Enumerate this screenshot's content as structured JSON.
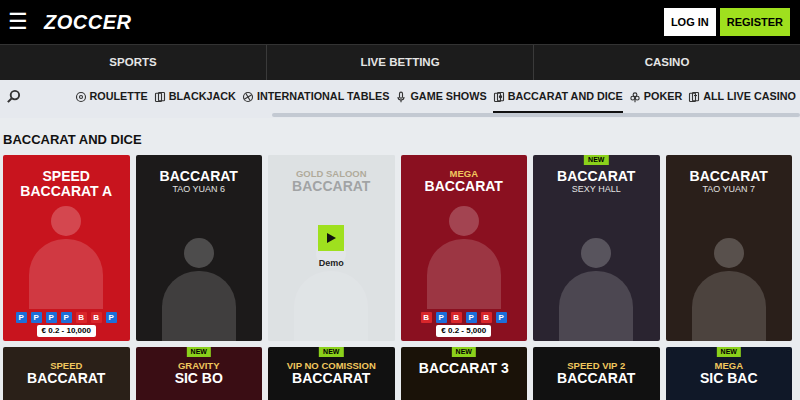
{
  "header": {
    "menu_icon": "☰",
    "logo": "ZOCCER",
    "login": "LOG IN",
    "register": "REGISTER"
  },
  "main_nav": [
    {
      "label": "SPORTS",
      "selected": false
    },
    {
      "label": "LIVE BETTING",
      "selected": false
    },
    {
      "label": "CASINO",
      "selected": false
    }
  ],
  "categories": [
    {
      "label": "ROULETTE",
      "selected": false
    },
    {
      "label": "BLACKJACK",
      "selected": false
    },
    {
      "label": "INTERNATIONAL TABLES",
      "selected": false
    },
    {
      "label": "GAME SHOWS",
      "selected": false
    },
    {
      "label": "BACCARAT AND DICE",
      "selected": true
    },
    {
      "label": "POKER",
      "selected": false
    },
    {
      "label": "ALL LIVE CASINO",
      "selected": false
    }
  ],
  "category_scroll": {
    "level": 0.66
  },
  "section_title": "BACCARAT AND DICE",
  "games": [
    {
      "tag": "",
      "title": "SPEED BACCARAT A",
      "subtitle": "",
      "color": "#c8141e",
      "hover": false,
      "road": [
        "P",
        "P",
        "P",
        "P",
        "B",
        "B",
        "P"
      ],
      "limits": "€ 0.2 - 10,000"
    },
    {
      "tag": "",
      "title": "BACCARAT",
      "subtitle": "TAO YUAN 6",
      "color": "#1c1a1a",
      "hover": false
    },
    {
      "tag": "GOLD SALOON",
      "title": "BACCARAT",
      "subtitle": "",
      "color": "#cfd2d6",
      "hover": true,
      "demo_label": "Demo"
    },
    {
      "tag": "MEGA",
      "title": "BACCARAT",
      "subtitle": "",
      "color": "#8a1020",
      "hover": false,
      "road": [
        "B",
        "P",
        "B",
        "P",
        "B",
        "P"
      ],
      "limits": "€ 0.2 - 5,000"
    },
    {
      "tag": "",
      "title": "BACCARAT",
      "subtitle": "SEXY HALL",
      "color": "#2a2430",
      "hover": false,
      "badge": "NEW"
    },
    {
      "tag": "",
      "title": "BACCARAT",
      "subtitle": "TAO YUAN 7",
      "color": "#2a1f1a",
      "hover": false
    },
    {
      "tag": "SPEED",
      "title": "BACCARAT",
      "subtitle": "",
      "color": "#2a2018",
      "hover": false
    },
    {
      "tag": "GRAVITY",
      "title": "SIC BO",
      "subtitle": "",
      "color": "#3a0d14",
      "hover": false,
      "badge": "NEW"
    },
    {
      "tag": "VIP NO COMISSION",
      "title": "BACCARAT",
      "subtitle": "",
      "color": "#111111",
      "hover": false,
      "badge": "NEW"
    },
    {
      "tag": "",
      "title": "BACCARAT 3",
      "subtitle": "",
      "color": "#1a1208",
      "hover": false,
      "badge": "NEW"
    },
    {
      "tag": "SPEED VIP 2",
      "title": "BACCARAT",
      "subtitle": "",
      "color": "#111111",
      "hover": false
    },
    {
      "tag": "MEGA",
      "title": "SIC BAC",
      "subtitle": "",
      "color": "#101828",
      "hover": false,
      "badge": "NEW"
    }
  ]
}
